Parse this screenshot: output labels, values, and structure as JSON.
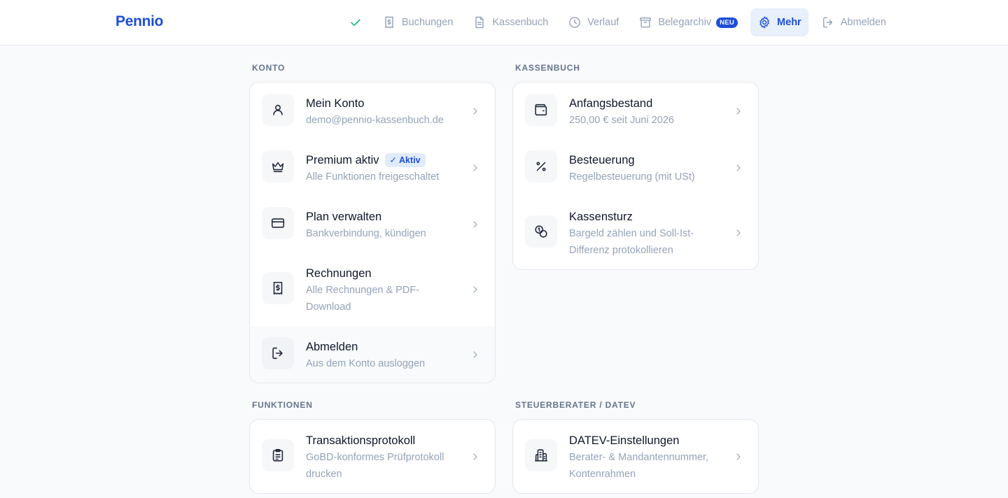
{
  "app": {
    "logo": "Pennio"
  },
  "nav": {
    "items": [
      {
        "id": "status",
        "icon": "check-icon",
        "label": ""
      },
      {
        "id": "buchungen",
        "icon": "receipt-dollar-icon",
        "label": "Buchungen"
      },
      {
        "id": "kassenbuch",
        "icon": "document-icon",
        "label": "Kassenbuch"
      },
      {
        "id": "verlauf",
        "icon": "clock-icon",
        "label": "Verlauf"
      },
      {
        "id": "belegarchiv",
        "icon": "archive-box-icon",
        "label": "Belegarchiv",
        "badge": "NEU"
      },
      {
        "id": "mehr",
        "icon": "gear-icon",
        "label": "Mehr",
        "active": true
      },
      {
        "id": "abmelden",
        "icon": "logout-icon",
        "label": "Abmelden"
      }
    ]
  },
  "sections": {
    "konto": {
      "title": "KONTO",
      "rows": [
        {
          "icon": "user-icon",
          "title": "Mein Konto",
          "subtitle": "demo@pennio-kassenbuch.de"
        },
        {
          "icon": "crown-icon",
          "title": "Premium aktiv",
          "badge": "✓ Aktiv",
          "subtitle": "Alle Funktionen freigeschaltet"
        },
        {
          "icon": "credit-card-icon",
          "title": "Plan verwalten",
          "subtitle": "Bankverbindung, kündigen"
        },
        {
          "icon": "receipt-dollar-icon",
          "title": "Rechnungen",
          "subtitle": "Alle Rechnungen & PDF-Download"
        },
        {
          "icon": "logout-icon",
          "title": "Abmelden",
          "subtitle": "Aus dem Konto ausloggen"
        }
      ]
    },
    "kassenbuch": {
      "title": "KASSENBUCH",
      "rows": [
        {
          "icon": "wallet-icon",
          "title": "Anfangsbestand",
          "subtitle": "250,00 € seit Juni 2026"
        },
        {
          "icon": "percent-icon",
          "title": "Besteuerung",
          "subtitle": "Regelbesteuerung (mit USt)"
        },
        {
          "icon": "coins-icon",
          "title": "Kassensturz",
          "subtitle": "Bargeld zählen und Soll-Ist-Differenz protokollieren"
        }
      ]
    },
    "funktionen": {
      "title": "FUNKTIONEN",
      "rows": [
        {
          "icon": "clipboard-list-icon",
          "title": "Transaktionsprotokoll",
          "subtitle": "GoBD-konformes Prüfprotokoll drucken"
        }
      ]
    },
    "datev": {
      "title": "STEUERBERATER / DATEV",
      "rows": [
        {
          "icon": "building-icon",
          "title": "DATEV-Einstellungen",
          "subtitle": "Berater- & Mandantennummer, Kontenrahmen"
        }
      ]
    }
  }
}
